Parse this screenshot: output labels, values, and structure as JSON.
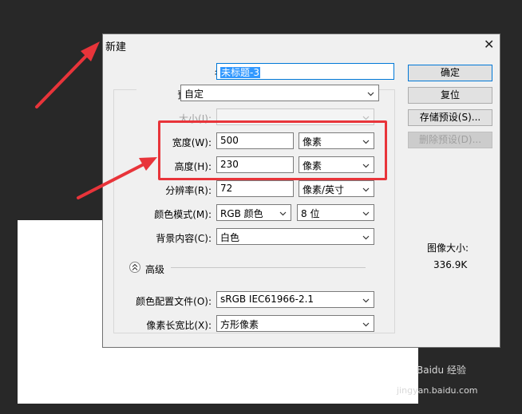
{
  "dialog": {
    "title": "新建",
    "name_label": "名称(N):",
    "name_value": "未标题-3",
    "preset_label": "预设(P):",
    "preset_value": "自定",
    "size_label": "大小(I):",
    "size_value": "",
    "width_label": "宽度(W):",
    "width_value": "500",
    "width_unit": "像素",
    "height_label": "高度(H):",
    "height_value": "230",
    "height_unit": "像素",
    "resolution_label": "分辨率(R):",
    "resolution_value": "72",
    "resolution_unit": "像素/英寸",
    "color_mode_label": "颜色模式(M):",
    "color_mode_value": "RGB 颜色",
    "bit_depth_value": "8 位",
    "background_label": "背景内容(C):",
    "background_value": "白色",
    "advanced_label": "高级",
    "color_profile_label": "颜色配置文件(O):",
    "color_profile_value": "sRGB IEC61966-2.1",
    "pixel_aspect_label": "像素长宽比(X):",
    "pixel_aspect_value": "方形像素",
    "buttons": {
      "ok": "确定",
      "reset": "复位",
      "save_preset": "存储预设(S)...",
      "delete_preset": "删除预设(D)..."
    },
    "image_size_label": "图像大小:",
    "image_size_value": "336.9K"
  },
  "watermark": {
    "brand": "Baidu 经验",
    "url": "jingyan.baidu.com"
  },
  "colors": {
    "annotation_red": "#e8343a",
    "selection_blue": "#3399ff",
    "primary_border": "#0078d7"
  }
}
